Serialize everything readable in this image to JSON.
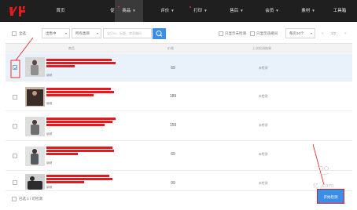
{
  "header": {
    "logo_text": "火牛",
    "nav": [
      {
        "label": "首页",
        "caret": false,
        "dot": false,
        "active": false
      },
      {
        "label": "促销",
        "caret": true,
        "dot": true,
        "active": false
      },
      {
        "label": "商品",
        "caret": true,
        "dot": true,
        "active": true
      },
      {
        "label": "评价",
        "caret": true,
        "dot": false,
        "active": false
      },
      {
        "label": "打印",
        "caret": true,
        "dot": true,
        "active": false
      },
      {
        "label": "售后",
        "caret": true,
        "dot": false,
        "active": false
      },
      {
        "label": "会员",
        "caret": true,
        "dot": false,
        "active": false
      },
      {
        "label": "素材",
        "caret": true,
        "dot": false,
        "active": false
      },
      {
        "label": "工具箱",
        "caret": false,
        "dot": false,
        "active": false
      }
    ]
  },
  "filters": {
    "select_all_label": "全选",
    "status_select": "出售中",
    "category_select": "所有类目",
    "search_placeholder": "宝贝ID、标题、商家编码",
    "only_unchecked": "只显示未检测",
    "only_violations": "只显示违规词",
    "per_page_select": "每页10个",
    "pager_prev": "<",
    "pager_text": "1/2",
    "pager_next": ">"
  },
  "table": {
    "headers": [
      "商品",
      "价格",
      "上次检测结果"
    ],
    "rows": [
      {
        "price": "69",
        "status": "未检测",
        "tag": "编辑",
        "checked": true,
        "thumb_color": "#9a9a9a"
      },
      {
        "price": "189",
        "status": "未检测",
        "tag": "编辑",
        "checked": false,
        "thumb_color": "#3a2c27"
      },
      {
        "price": "159",
        "status": "未检测",
        "tag": "编辑",
        "checked": false,
        "thumb_color": "#6e6e6e"
      },
      {
        "price": "69",
        "status": "未检测",
        "tag": "编辑",
        "checked": false,
        "thumb_color": "#555a60"
      },
      {
        "price": "99",
        "status": "未检测",
        "tag": "编辑",
        "checked": false,
        "thumb_color": "#2c2c2c"
      }
    ]
  },
  "footer": {
    "selected_text": "已选 1 / 可检测",
    "cta_label": "开始检测"
  },
  "watermark": {
    "text": "亿 .com"
  },
  "colors": {
    "nav_bg": "#1f1f1f",
    "accent": "#3a8ee6",
    "highlight": "#e8191c",
    "selected_row": "#e9f2fb"
  }
}
